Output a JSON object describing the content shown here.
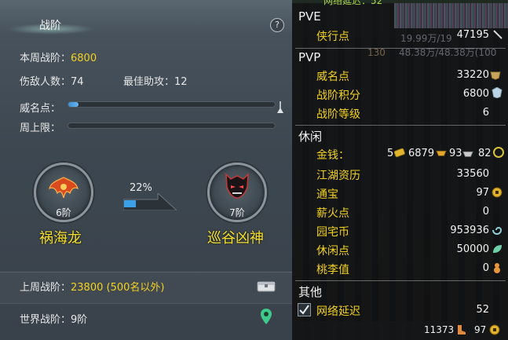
{
  "left": {
    "title": "战阶",
    "help": "?",
    "week_rank_label": "本周战阶：",
    "week_rank_value": "6800",
    "kills_label": "伤敌人数：",
    "kills_value": "74",
    "assists_label": "最佳助攻：",
    "assists_value": "12",
    "prestige_label": "威名点：",
    "prestige_progress": 0.05,
    "weekly_cap_label": "周上限：",
    "weekly_cap_progress": 0,
    "current_medal": {
      "rank": "6阶",
      "name": "祸海龙"
    },
    "next_medal": {
      "rank": "7阶",
      "name": "巡谷凶神"
    },
    "advance_percent": "22%",
    "advance_progress": 0.22,
    "last_week_label": "上周战阶：",
    "last_week_value": "23800 (500名以外)",
    "world_label": "世界战阶：",
    "world_value": "9阶"
  },
  "right": {
    "pve": {
      "title": "PVE",
      "items": [
        {
          "label": "侠行点",
          "value": "47195"
        }
      ],
      "bg_text": [
        "19.99万/19",
        "48.38万/48.38万(100"
      ],
      "level_badge": "130"
    },
    "pvp": {
      "title": "PVP",
      "items": [
        {
          "label": "威名点",
          "value": "33220"
        },
        {
          "label": "战阶积分",
          "value": "6800"
        },
        {
          "label": "战阶等级",
          "value": "6"
        }
      ]
    },
    "leisure": {
      "title": "休闲",
      "money_label": "金钱：",
      "money_gold": "5",
      "money_silver": "6879",
      "money_copper": "93",
      "money_extra": "82",
      "items": [
        {
          "label": "江湖资历",
          "value": "33560"
        },
        {
          "label": "通宝",
          "value": "97"
        },
        {
          "label": "薪火点",
          "value": "0"
        },
        {
          "label": "园宅币",
          "value": "953936"
        },
        {
          "label": "休闲点",
          "value": "50000"
        },
        {
          "label": "桃李值",
          "value": "0"
        }
      ]
    },
    "other": {
      "title": "其他",
      "latency_label": "网络延迟",
      "latency_value": "52"
    },
    "top_partial": "网络延迟：52",
    "footer": {
      "value1": "11373",
      "value2": "97"
    }
  },
  "colors": {
    "accent_yellow": "#f2d21f",
    "progress_blue": "#3b8fd6",
    "panel_left": "#3d4750",
    "panel_right": "#1d2024"
  }
}
